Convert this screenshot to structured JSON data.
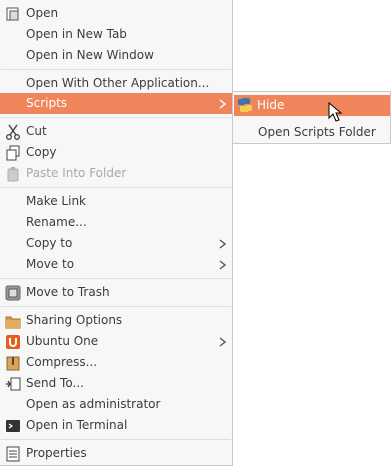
{
  "colors": {
    "highlight": "#f0845a",
    "menu_bg": "#f7f7f7",
    "text": "#3c3c3c",
    "disabled_text": "#a8a8a8",
    "separator": "#dedede"
  },
  "menu": {
    "items": [
      {
        "label": "Open",
        "icon": "open-file-icon"
      },
      {
        "label": "Open in New Tab"
      },
      {
        "label": "Open in New Window"
      },
      {
        "label": "Open With Other Application..."
      },
      {
        "label": "Scripts",
        "submenu": true,
        "highlighted": true
      },
      {
        "label": "Cut",
        "icon": "scissors-icon"
      },
      {
        "label": "Copy",
        "icon": "copy-icon"
      },
      {
        "label": "Paste Into Folder",
        "icon": "paste-icon",
        "disabled": true
      },
      {
        "label": "Make Link"
      },
      {
        "label": "Rename..."
      },
      {
        "label": "Copy to",
        "submenu": true
      },
      {
        "label": "Move to",
        "submenu": true
      },
      {
        "label": "Move to Trash",
        "icon": "trash-icon"
      },
      {
        "label": "Sharing Options",
        "icon": "folder-share-icon"
      },
      {
        "label": "Ubuntu One",
        "icon": "ubuntu-one-icon",
        "submenu": true
      },
      {
        "label": "Compress...",
        "icon": "archive-icon"
      },
      {
        "label": "Send To...",
        "icon": "send-to-icon"
      },
      {
        "label": "Open as administrator"
      },
      {
        "label": "Open in Terminal",
        "icon": "terminal-icon"
      },
      {
        "label": "Properties",
        "icon": "properties-icon"
      }
    ]
  },
  "scripts_submenu": {
    "items": [
      {
        "label": "Hide",
        "icon": "python-icon",
        "highlighted": true
      },
      {
        "label": "Open Scripts Folder"
      }
    ]
  }
}
